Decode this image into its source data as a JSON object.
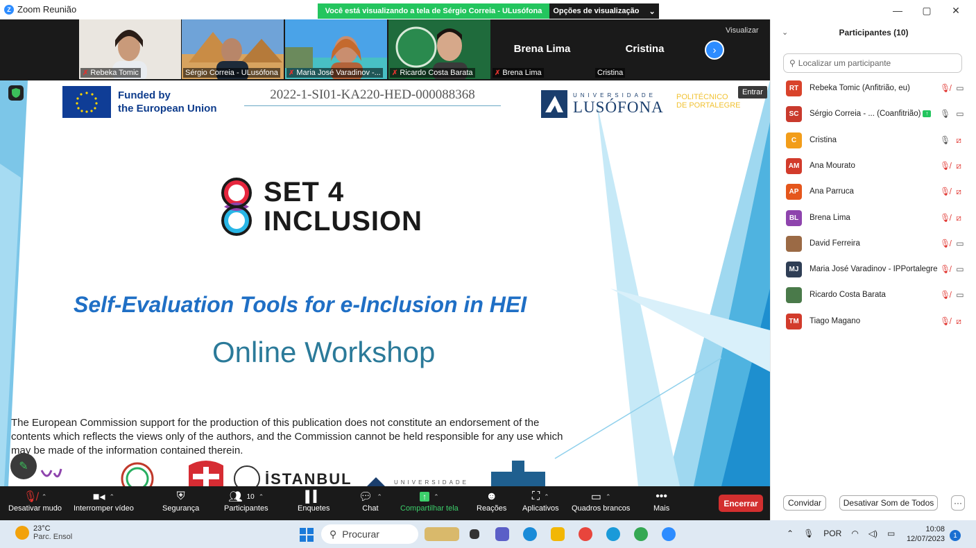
{
  "window": {
    "title": "Zoom Reunião",
    "share_banner": "Você está visualizando a tela de Sérgio Correia - ULusófona",
    "view_options": "Opções de visualização",
    "minimize": "—",
    "maximize": "▢",
    "close": "✕"
  },
  "strip": {
    "view_label": "Visualizar",
    "tiles": [
      {
        "label": "Rebeka Tomic",
        "muted": true,
        "bigname": ""
      },
      {
        "label": "Sérgio Correia - ULusófona",
        "muted": false,
        "bigname": ""
      },
      {
        "label": "Maria José Varadinov -...",
        "muted": true,
        "bigname": ""
      },
      {
        "label": "Ricardo Costa Barata",
        "muted": true,
        "bigname": ""
      },
      {
        "label": "Brena Lima",
        "muted": true,
        "bigname": "Brena Lima"
      },
      {
        "label": "Cristina",
        "muted": false,
        "bigname": "Cristina"
      }
    ]
  },
  "slide": {
    "funded_line1": "Funded by",
    "funded_line2": "the European Union",
    "project_code": "2022-1-SI01-KA220-HED-000088368",
    "univ_small": "UNIVERSIDADE",
    "univ_name": "LUSÓFONA",
    "portal_line1": "POLITÉCNICO",
    "portal_line2": "DE PORTALEGRE",
    "enter_label": "Entrar",
    "logo_line1": "SET 4",
    "logo_line2": "INCLUSION",
    "subtitle": "Self-Evaluation Tools for e-Inclusion in HEI",
    "workshop": "Online Workshop",
    "disclaimer": "The European Commission support for the production of this publication does not constitute an endorsement of the contents  which reflects the views only of the authors, and the Commission cannot be held responsible for any use which may be made  of the information contained therein.",
    "istanbul": "İSTANBUL",
    "univ_footer": "UNIVERSIDADE"
  },
  "panel": {
    "title": "Participantes (10)",
    "search_placeholder": "Localizar um participante",
    "participants": [
      {
        "initials": "RT",
        "color": "#d9432b",
        "name": "Rebeka Tomic (Anfitrião, eu)",
        "mic": "off",
        "cam": "on"
      },
      {
        "initials": "SC",
        "color": "#c93a2d",
        "name": "Sérgio Correia - ... (Coanfitrião)",
        "mic": "on",
        "cam": "on",
        "sharing": true
      },
      {
        "initials": "C",
        "color": "#f29d1a",
        "name": "Cristina",
        "mic": "on",
        "cam": "off"
      },
      {
        "initials": "AM",
        "color": "#d23b2b",
        "name": "Ana Mourato",
        "mic": "off",
        "cam": "off"
      },
      {
        "initials": "AP",
        "color": "#e5561c",
        "name": "Ana Parruca",
        "mic": "off",
        "cam": "off"
      },
      {
        "initials": "BL",
        "color": "#8e44ad",
        "name": "Brena Lima",
        "mic": "off",
        "cam": "off"
      },
      {
        "initials": "",
        "color": "#9b6a45",
        "name": "David Ferreira",
        "mic": "off",
        "cam": "on"
      },
      {
        "initials": "MJ",
        "color": "#2f3e55",
        "name": "Maria José Varadinov - IPPortalegre",
        "mic": "off",
        "cam": "on"
      },
      {
        "initials": "",
        "color": "#4a7a4a",
        "name": "Ricardo Costa Barata",
        "mic": "off",
        "cam": "on"
      },
      {
        "initials": "TM",
        "color": "#d23b2b",
        "name": "Tiago Magano",
        "mic": "off",
        "cam": "off"
      }
    ],
    "invite": "Convidar",
    "mute_all": "Desativar Som de Todos",
    "more": "···"
  },
  "toolbar": {
    "mute": "Desativar mudo",
    "video": "Interromper vídeo",
    "security": "Segurança",
    "participants": "Participantes",
    "participants_count": "10",
    "polls": "Enquetes",
    "chat": "Chat",
    "share": "Compartilhar tela",
    "reactions": "Reações",
    "apps": "Aplicativos",
    "whiteboards": "Quadros brancos",
    "more": "Mais",
    "end": "Encerrar"
  },
  "taskbar": {
    "temp": "23°C",
    "weather": "Parc. Ensol",
    "search": "Procurar",
    "lang": "POR",
    "time": "10:08",
    "date": "12/07/2023",
    "notifications": "1"
  }
}
